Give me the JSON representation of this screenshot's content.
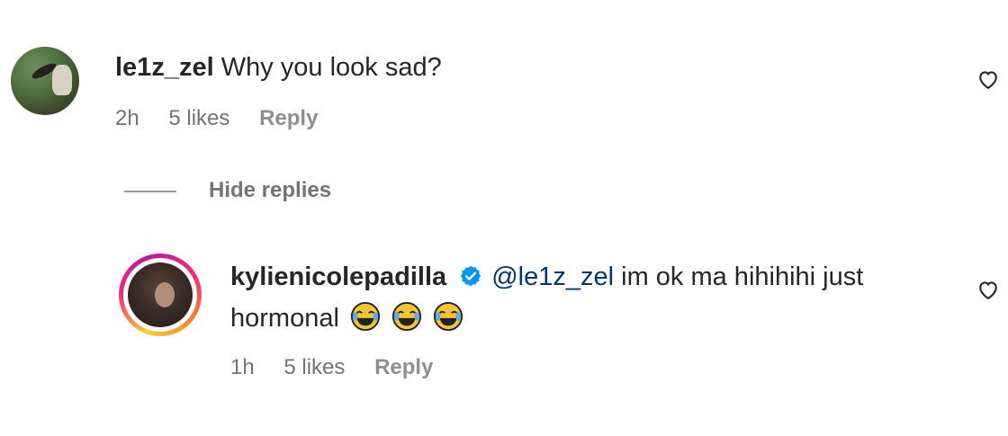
{
  "comments": [
    {
      "username": "le1z_zel",
      "text": "Why you look sad?",
      "time": "2h",
      "likes": "5 likes",
      "reply_label": "Reply"
    }
  ],
  "hide_replies_label": "Hide replies",
  "replies": [
    {
      "username": "kylienicolepadilla",
      "verified": true,
      "mention": "@le1z_zel",
      "text": "im ok ma hihihihi just",
      "text_line2": "hormonal",
      "emojis": [
        "face-with-tears-of-joy",
        "face-with-tears-of-joy",
        "face-with-tears-of-joy"
      ],
      "time": "1h",
      "likes": "5 likes",
      "reply_label": "Reply"
    }
  ],
  "colors": {
    "text": "#262626",
    "meta": "#737373",
    "mention": "#00376b",
    "verified": "#0095f6"
  },
  "icons": {
    "like": "heart-outline-icon",
    "verified": "verified-badge-icon",
    "emoji": "face-with-tears-of-joy"
  }
}
